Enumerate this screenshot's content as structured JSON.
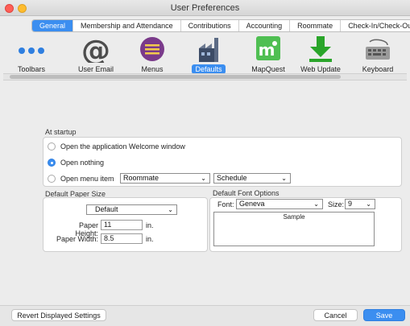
{
  "window": {
    "title": "User Preferences"
  },
  "tabs": [
    {
      "label": "General",
      "active": true
    },
    {
      "label": "Membership and Attendance",
      "active": false
    },
    {
      "label": "Contributions",
      "active": false
    },
    {
      "label": "Accounting",
      "active": false
    },
    {
      "label": "Roommate",
      "active": false
    },
    {
      "label": "Check-In/Check-Out",
      "active": false
    }
  ],
  "toolbar": {
    "items": [
      {
        "label": "Toolbars",
        "icon": "dots-icon"
      },
      {
        "label": "User Email",
        "icon": "at-sign-icon"
      },
      {
        "label": "Menus",
        "icon": "menu-icon"
      },
      {
        "label": "Defaults",
        "icon": "factory-icon",
        "selected": true
      },
      {
        "label": "MapQuest",
        "icon": "mapquest-icon"
      },
      {
        "label": "Web Update",
        "icon": "download-arrow-icon"
      },
      {
        "label": "Keyboard",
        "icon": "keyboard-icon"
      }
    ],
    "mapquest_glyph": "m"
  },
  "startup": {
    "label": "At startup",
    "options": [
      {
        "label": "Open the application Welcome window",
        "selected": false
      },
      {
        "label": "Open nothing",
        "selected": true
      },
      {
        "label": "Open menu item",
        "selected": false
      }
    ],
    "menu_item_primary": "Roommate",
    "menu_item_secondary": "Schedule"
  },
  "paper": {
    "label": "Default Paper Size",
    "size": "Default",
    "height_label": "Paper Height:",
    "height_value": "11",
    "height_unit": "in.",
    "width_label": "Paper Width:",
    "width_value": "8.5",
    "width_unit": "in."
  },
  "font": {
    "label": "Default Font Options",
    "font_label": "Font:",
    "font_value": "Geneva",
    "size_label": "Size:",
    "size_value": "9",
    "sample_label": "Sample"
  },
  "buttons": {
    "revert": "Revert Displayed Settings",
    "cancel": "Cancel",
    "save": "Save"
  },
  "colors": {
    "accent": "#3b8ef0",
    "close": "#ff5f57",
    "minimize": "#febc2e",
    "mapquest": "#4fbf52",
    "download": "#2aa52a"
  }
}
